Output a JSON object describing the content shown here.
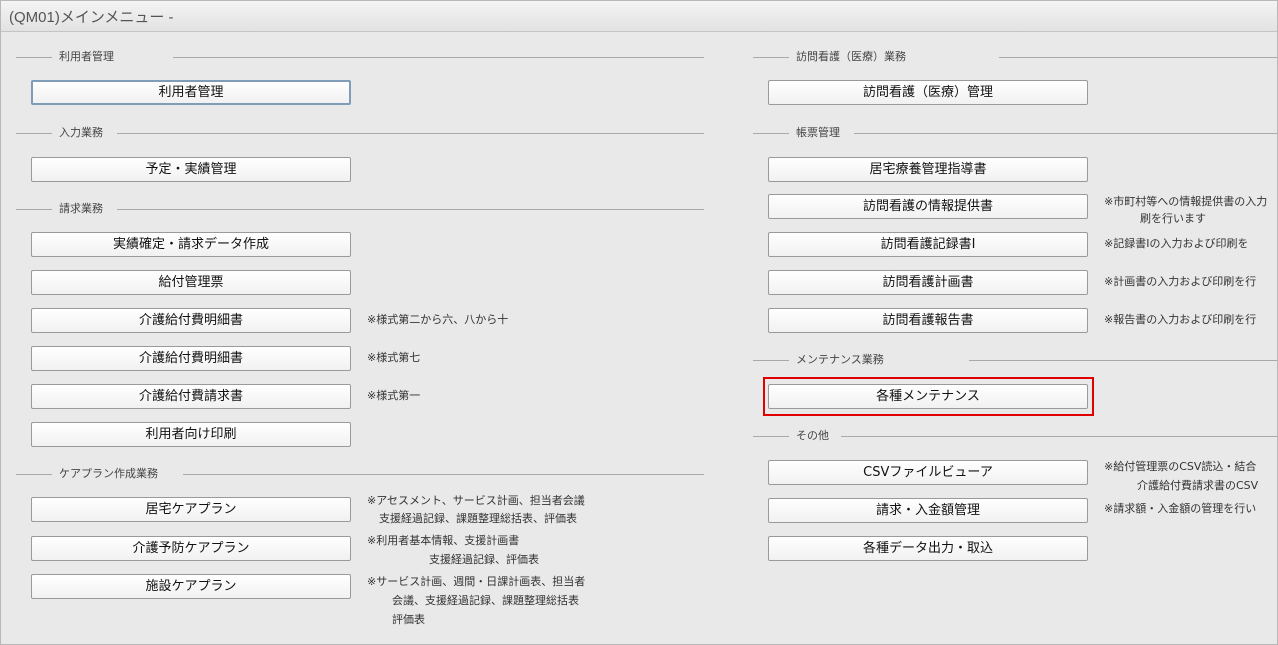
{
  "window": {
    "title": "(QM01)メインメニュー -"
  },
  "left": {
    "users": {
      "label": "利用者管理",
      "btn_user": "利用者管理"
    },
    "input": {
      "label": "入力業務",
      "btn_schedule": "予定・実績管理"
    },
    "billing": {
      "label": "請求業務",
      "btn_confirm": "実績確定・請求データ作成",
      "btn_benefit": "給付管理票",
      "btn_detail1": "介護給付費明細書",
      "note_detail1": "※様式第二から六、八から十",
      "btn_detail2": "介護給付費明細書",
      "note_detail2": "※様式第七",
      "btn_invoice": "介護給付費請求書",
      "note_invoice": "※様式第一",
      "btn_print": "利用者向け印刷"
    },
    "careplan": {
      "label": "ケアプラン作成業務",
      "btn_home": "居宅ケアプラン",
      "note_home_1": "※アセスメント、サービス計画、担当者会議",
      "note_home_2": "支援経過記録、課題整理総括表、評価表",
      "btn_prevent": "介護予防ケアプラン",
      "note_prevent_1": "※利用者基本情報、支援計画書",
      "note_prevent_2": "支援経過記録、評価表",
      "btn_facility": "施設ケアプラン",
      "note_facility_1": "※サービス計画、週間・日課計画表、担当者",
      "note_facility_2": "会議、支援経過記録、課題整理総括表",
      "note_facility_3": "評価表"
    }
  },
  "right": {
    "visit": {
      "label": "訪問看護（医療）業務",
      "btn_manage": "訪問看護（医療）管理"
    },
    "forms": {
      "label": "帳票管理",
      "btn_home_guide": "居宅療養管理指導書",
      "btn_info": "訪問看護の情報提供書",
      "note_info_1": "※市町村等への情報提供書の入力",
      "note_info_2": "刷を行います",
      "btn_record": "訪問看護記録書Ⅰ",
      "note_record": "※記録書Ⅰの入力および印刷を",
      "btn_plan": "訪問看護計画書",
      "note_plan": "※計画書の入力および印刷を行",
      "btn_report": "訪問看護報告書",
      "note_report": "※報告書の入力および印刷を行"
    },
    "maintenance": {
      "label": "メンテナンス業務",
      "btn_maint": "各種メンテナンス"
    },
    "other": {
      "label": "その他",
      "btn_csv": "CSVファイルビューア",
      "note_csv_1": "※給付管理票のCSV読込・結合",
      "note_csv_2": "介護給付費請求書のCSV",
      "btn_amount": "請求・入金額管理",
      "note_amount": "※請求額・入金額の管理を行い",
      "btn_export": "各種データ出力・取込"
    }
  },
  "colors": {
    "highlight": "#e00000",
    "background": "#e9e9e9",
    "selected_border": "#7f9db9"
  }
}
